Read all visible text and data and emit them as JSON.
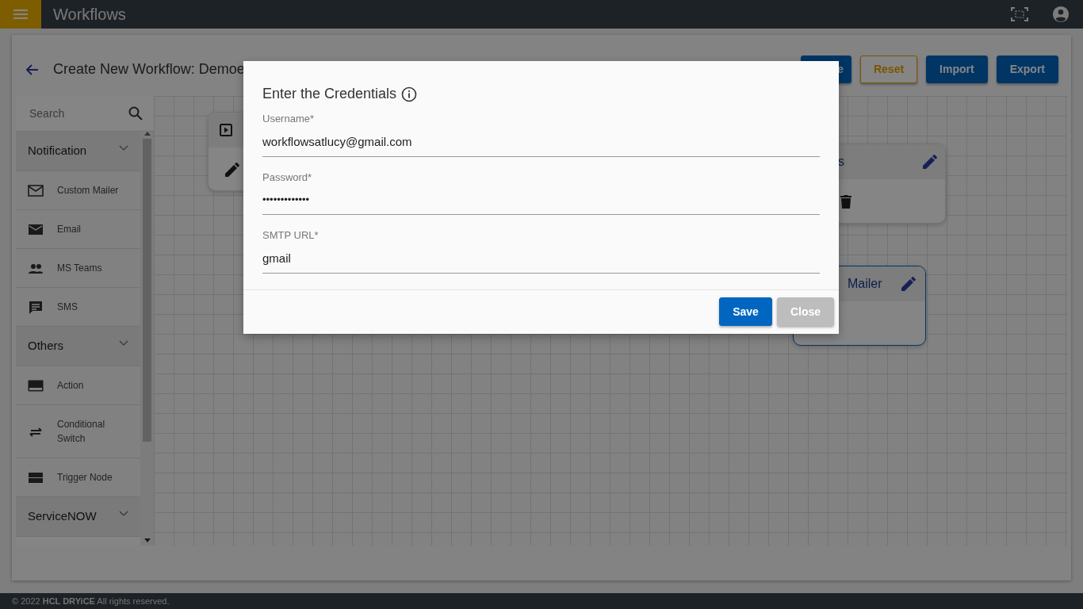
{
  "app_bar": {
    "title": "Workflows"
  },
  "page": {
    "title": "Create New Workflow: Demoe",
    "buttons": [
      {
        "label": "e",
        "kind": "primary"
      },
      {
        "label": "Reset",
        "kind": "outline"
      },
      {
        "label": "Import",
        "kind": "primary"
      },
      {
        "label": "Export",
        "kind": "primary"
      }
    ]
  },
  "sidebar": {
    "search": {
      "placeholder": "Search"
    },
    "groups": [
      {
        "label": "Notification",
        "items": [
          {
            "label": "Custom Mailer"
          },
          {
            "label": "Email"
          },
          {
            "label": "MS Teams"
          },
          {
            "label": "SMS"
          }
        ]
      },
      {
        "label": "Others",
        "items": [
          {
            "label": "Action"
          },
          {
            "label": "Conditional Switch"
          },
          {
            "label": "Trigger Node"
          }
        ]
      },
      {
        "label": "ServiceNOW"
      }
    ]
  },
  "canvas": {
    "nodes": [
      {
        "selected": false
      },
      {
        "title": "s",
        "selected": false
      },
      {
        "title": "Mailer",
        "selected": true
      }
    ]
  },
  "dialog": {
    "title": "Enter the Credentials",
    "fields": [
      {
        "label": "Username*",
        "value": "workflowsatlucy@gmail.com",
        "kind": "text"
      },
      {
        "label": "Password*",
        "value": "•••••••••••••",
        "kind": "password"
      },
      {
        "label": "SMTP URL*",
        "value": "gmail",
        "kind": "text"
      }
    ],
    "buttons": [
      {
        "label": "Save",
        "kind": "primary"
      },
      {
        "label": "Close",
        "kind": "secondary"
      }
    ]
  },
  "footer": {
    "text": "© 2022 **HCL DRYiCE** All rights reserved."
  }
}
